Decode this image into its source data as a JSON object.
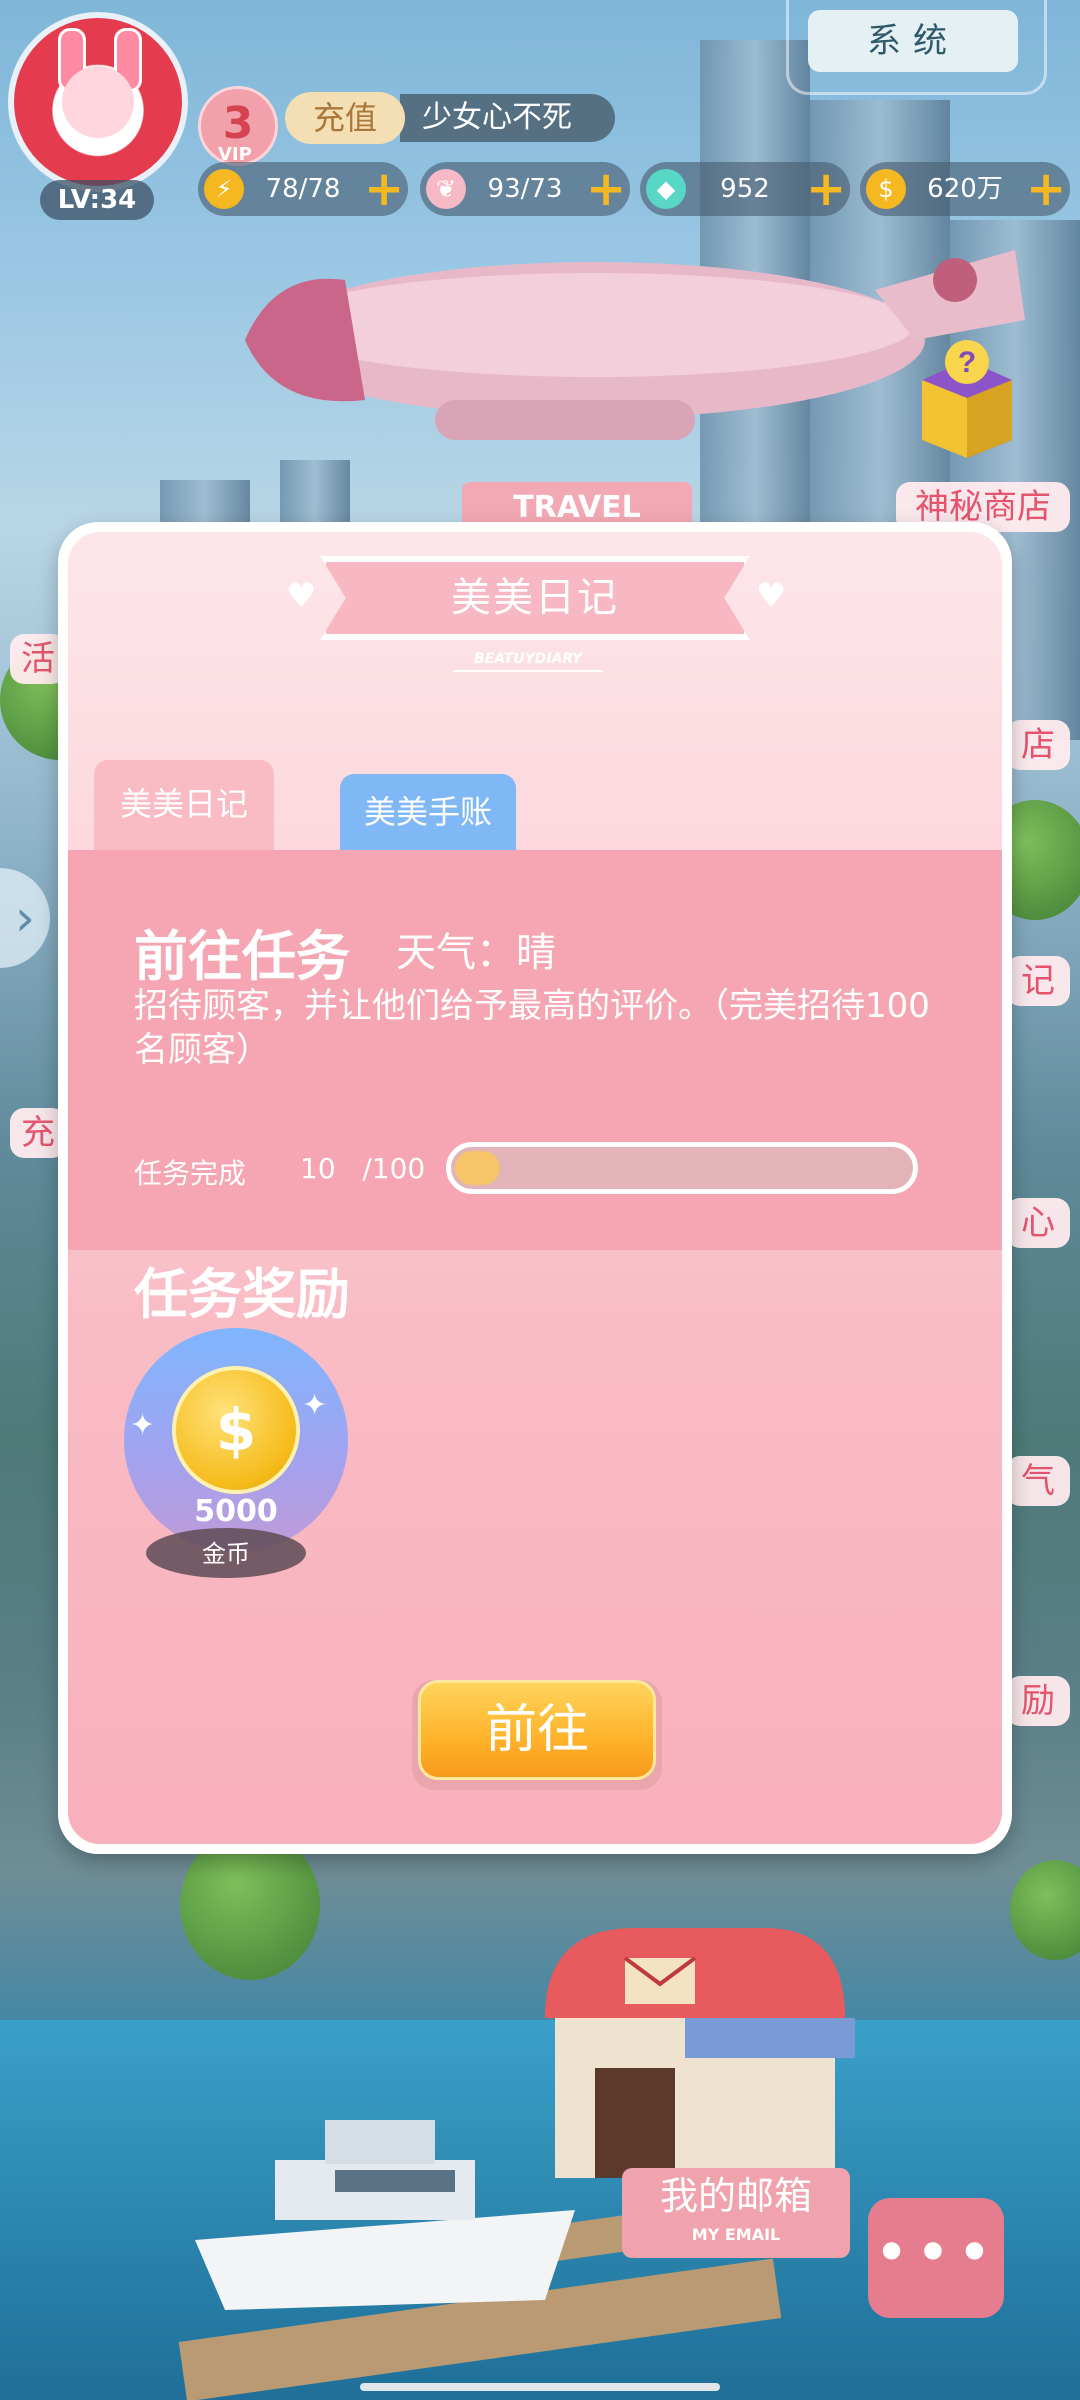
{
  "player": {
    "level": "LV:34",
    "vip_level": "3",
    "vip_tag": "VIP",
    "recharge_label": "充值",
    "nickname": "少女心不死"
  },
  "system_button": "系统",
  "resources": [
    {
      "icon": "lightning-icon",
      "value": "78/78"
    },
    {
      "icon": "wing-icon",
      "value": "93/73"
    },
    {
      "icon": "diamond-icon",
      "value": "952"
    },
    {
      "icon": "coin-icon",
      "value": "620万"
    }
  ],
  "scene": {
    "travel_sign": "TRAVEL",
    "mystery_shop": "神秘商店",
    "right_labels": [
      "店",
      "记",
      "心",
      "气",
      "励"
    ],
    "left_labels": [
      "活",
      "充"
    ],
    "mailbox_label": "我的邮箱",
    "mailbox_label_en": "MY EMAIL",
    "more_button": "•••"
  },
  "dialog": {
    "banner_title": "美美日记",
    "banner_subtitle": "BEATUYDIARY",
    "tabs": [
      {
        "label": "美美日记",
        "active": true
      },
      {
        "label": "美美手账",
        "active": false
      }
    ],
    "task_title": "前往任务",
    "weather": "天气：晴",
    "task_description": "招待顾客，并让他们给予最高的评价。（完美招待100名顾客）",
    "progress_label": "任务完成",
    "progress_current": "10",
    "progress_total": "/100",
    "progress_fraction": 0.1,
    "reward_title": "任务奖励",
    "rewards": [
      {
        "icon": "gold-coin-icon",
        "amount": "5000",
        "name": "金币"
      }
    ],
    "go_button": "前往"
  },
  "colors": {
    "accent_pink": "#f6a6b2",
    "tab_blue": "#7fb8f5",
    "button_orange": "#ffb22b",
    "progress_fill": "#f6c569"
  }
}
